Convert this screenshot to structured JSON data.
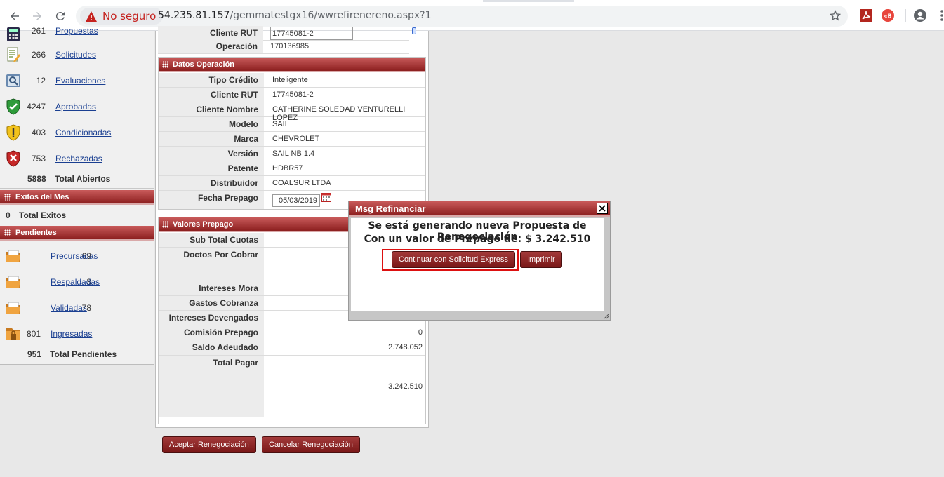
{
  "browser": {
    "security_label": "No seguro",
    "url_host": "54.235.81.157",
    "url_path": "/gemmatestgx16/wwrefirenereno.aspx?1"
  },
  "sidebar": {
    "abiertos": [
      {
        "count": "261",
        "label": "Propuestas",
        "icon": "calculator-icon"
      },
      {
        "count": "266",
        "label": "Solicitudes",
        "icon": "document-pen-icon"
      },
      {
        "count": "12",
        "label": "Evaluaciones",
        "icon": "magnifier-icon"
      },
      {
        "count": "4247",
        "label": "Aprobadas",
        "icon": "green-shield-check-icon"
      },
      {
        "count": "403",
        "label": "Condicionadas",
        "icon": "yellow-shield-warning-icon"
      },
      {
        "count": "753",
        "label": "Rechazadas",
        "icon": "red-shield-x-icon"
      }
    ],
    "total_abiertos": {
      "count": "5888",
      "label": "Total Abiertos"
    },
    "exitos_header": "Exitos del Mes",
    "total_exitos": {
      "count": "0",
      "label": "Total Exitos"
    },
    "pendientes_header": "Pendientes",
    "pendientes": [
      {
        "count": "69",
        "label": "Precursadas",
        "icon": "folder-icon"
      },
      {
        "count": "3",
        "label": "Respaldadas",
        "icon": "folder-icon"
      },
      {
        "count": "78",
        "label": "Validadas",
        "icon": "folder-icon"
      },
      {
        "count": "801",
        "label": "Ingresadas",
        "icon": "folder-locked-icon"
      }
    ],
    "total_pendientes": {
      "count": "951",
      "label": "Total Pendientes"
    }
  },
  "top": {
    "cliente_rut_label": "Cliente RUT",
    "cliente_rut_value": "17745081-2",
    "operacion_label": "Operación",
    "operacion_value": "170136985"
  },
  "datos_operacion": {
    "title": "Datos Operación",
    "rows": [
      {
        "label": "Tipo Crédito",
        "value": "Inteligente"
      },
      {
        "label": "Cliente RUT",
        "value": "17745081-2"
      },
      {
        "label": "Cliente Nombre",
        "value": "CATHERINE SOLEDAD VENTURELLI LOPEZ"
      },
      {
        "label": "Modelo",
        "value": "SAIL"
      },
      {
        "label": "Marca",
        "value": "CHEVROLET"
      },
      {
        "label": "Versión",
        "value": "SAIL NB 1.4"
      },
      {
        "label": "Patente",
        "value": "HDBR57"
      },
      {
        "label": "Distribuidor",
        "value": "COALSUR LTDA"
      }
    ],
    "fecha_label": "Fecha Prepago",
    "fecha_value": "05/03/2019"
  },
  "valores_prepago": {
    "title": "Valores Prepago",
    "sub_total_cuotas": "Sub Total Cuotas",
    "doctos_por_cobrar": "Doctos Por Cobrar",
    "intereses_mora": "Intereses Mora",
    "gastos_cobranza": "Gastos Cobranza",
    "intereses_devengados": "Intereses Devengados",
    "comision_prepago": "Comisión Prepago",
    "comision_value": "0",
    "saldo_adeudado": "Saldo Adeudado",
    "saldo_value": "2.748.052",
    "total_pagar": "Total Pagar",
    "total_value": "3.242.510"
  },
  "actions": {
    "aceptar": "Aceptar Renegociación",
    "cancelar": "Cancelar Renegociación"
  },
  "modal": {
    "title": "Msg Refinanciar",
    "line1": "Se está generando nueva Propuesta de Renegociación",
    "line2": "Con un valor de Prepago de: $ 3.242.510",
    "continuar": "Continuar con Solicitud Express",
    "imprimir": "Imprimir"
  }
}
